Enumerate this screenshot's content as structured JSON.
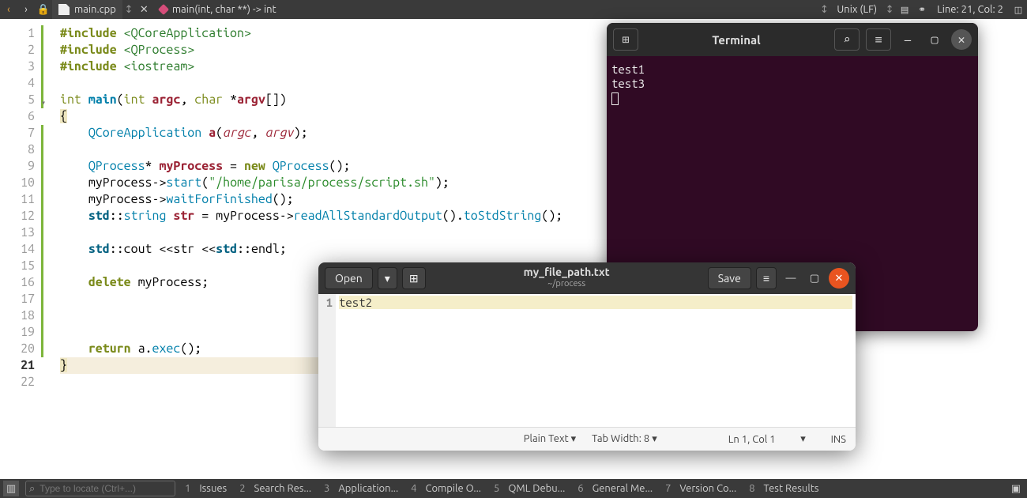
{
  "topbar": {
    "file_tab": "main.cpp",
    "symbol_tab": "main(int, char **) -> int",
    "line_enc": "Unix (LF)",
    "cursor": "Line: 21, Col: 2"
  },
  "code": {
    "lines": [
      {
        "n": 1,
        "bar": true
      },
      {
        "n": 2,
        "bar": true
      },
      {
        "n": 3,
        "bar": true
      },
      {
        "n": 4,
        "bar": true
      },
      {
        "n": 5,
        "bar": true,
        "fold": true
      },
      {
        "n": 6,
        "bar": false
      },
      {
        "n": 7,
        "bar": true
      },
      {
        "n": 8,
        "bar": true
      },
      {
        "n": 9,
        "bar": true
      },
      {
        "n": 10,
        "bar": true
      },
      {
        "n": 11,
        "bar": true
      },
      {
        "n": 12,
        "bar": true
      },
      {
        "n": 13,
        "bar": true
      },
      {
        "n": 14,
        "bar": true
      },
      {
        "n": 15,
        "bar": true
      },
      {
        "n": 16,
        "bar": true
      },
      {
        "n": 17,
        "bar": true
      },
      {
        "n": 18,
        "bar": true
      },
      {
        "n": 19,
        "bar": true
      },
      {
        "n": 20,
        "bar": true
      },
      {
        "n": 21,
        "bar": false,
        "current": true
      },
      {
        "n": 22,
        "bar": false
      }
    ],
    "include1_kw": "#include",
    "include1_lib": "<QCoreApplication>",
    "include2_kw": "#include",
    "include2_lib": "<QProcess>",
    "include3_kw": "#include",
    "include3_lib": "<iostream>",
    "sig_int": "int",
    "sig_main": "main",
    "sig_open": "(",
    "sig_pint": "int",
    "sig_argc": "argc",
    "sig_comma": ", ",
    "sig_char": "char",
    "sig_star": " *",
    "sig_argv": "argv",
    "sig_brk": "[])",
    "brace_open": "{",
    "l7_ty": "QCoreApplication",
    "l7_sp": " ",
    "l7_var": "a",
    "l7_o": "(",
    "l7_a1": "argc",
    "l7_c": ", ",
    "l7_a2": "argv",
    "l7_e": ");",
    "l9_ty": "QProcess",
    "l9_s": "* ",
    "l9_var": "myProcess",
    "l9_eq": " = ",
    "l9_new": "new",
    "l9_sp": " ",
    "l9_ty2": "QProcess",
    "l9_e": "();",
    "l10_pre": "myProcess->",
    "l10_fn": "start",
    "l10_o": "(",
    "l10_str": "\"/home/parisa/process/script.sh\"",
    "l10_e": ");",
    "l11_pre": "myProcess->",
    "l11_fn": "waitForFinished",
    "l11_e": "();",
    "l12_ns": "std",
    "l12_cc": "::",
    "l12_ty": "string",
    "l12_sp": " ",
    "l12_var": "str",
    "l12_eq": " = myProcess->",
    "l12_fn1": "readAllStandardOutput",
    "l12_p": "().",
    "l12_fn2": "toStdString",
    "l12_e": "();",
    "l14_ns": "std",
    "l14_cc": "::",
    "l14_cout": "cout",
    "l14_op1": " <<",
    "l14_v": "str",
    "l14_op2": " <<",
    "l14_ns2": "std",
    "l14_cc2": "::",
    "l14_endl": "endl",
    "l14_e": ";",
    "l16_del": "delete",
    "l16_sp": " ",
    "l16_v": "myProcess",
    "l16_e": ";",
    "l20_ret": "return",
    "l20_sp": " ",
    "l20_a": "a",
    "l20_dot": ".",
    "l20_fn": "exec",
    "l20_e": "();",
    "brace_close": "}"
  },
  "terminal": {
    "title": "Terminal",
    "line1": "test1",
    "line2": "test3"
  },
  "gedit": {
    "open_label": "Open",
    "save_label": "Save",
    "title": "my_file_path.txt",
    "subtitle": "~/process",
    "line_no": "1",
    "content": "test2",
    "status_type": "Plain Text",
    "status_tab": "Tab Width: 8",
    "status_pos": "Ln 1, Col 1",
    "status_ins": "INS"
  },
  "bottom": {
    "search_placeholder": "Type to locate (Ctrl+...)",
    "tabs": [
      {
        "n": "1",
        "label": "Issues"
      },
      {
        "n": "2",
        "label": "Search Res..."
      },
      {
        "n": "3",
        "label": "Application..."
      },
      {
        "n": "4",
        "label": "Compile O..."
      },
      {
        "n": "5",
        "label": "QML Debu..."
      },
      {
        "n": "6",
        "label": "General Me..."
      },
      {
        "n": "7",
        "label": "Version Co..."
      },
      {
        "n": "8",
        "label": "Test Results"
      }
    ]
  }
}
